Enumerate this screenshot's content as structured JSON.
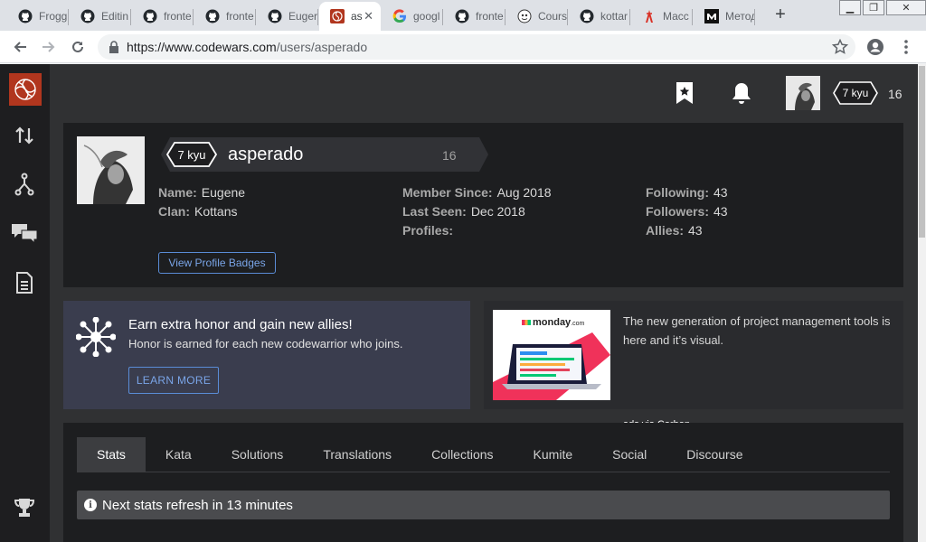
{
  "browser": {
    "tabs": [
      {
        "label": "Frogg",
        "icon": "github-icon"
      },
      {
        "label": "Editin",
        "icon": "github-icon"
      },
      {
        "label": "fronte",
        "icon": "github-icon"
      },
      {
        "label": "fronte",
        "icon": "github-icon"
      },
      {
        "label": "Euger",
        "icon": "github-icon"
      },
      {
        "label": "as",
        "icon": "codewars-icon",
        "active": true
      },
      {
        "label": "googl",
        "icon": "google-icon"
      },
      {
        "label": "fronte",
        "icon": "github-icon"
      },
      {
        "label": "Cours",
        "icon": "course-icon"
      },
      {
        "label": "kottar",
        "icon": "github-icon"
      },
      {
        "label": "Масс",
        "icon": "tower-icon"
      },
      {
        "label": "Метод",
        "icon": "m-icon"
      }
    ],
    "url_host": "https://www.codewars.com",
    "url_path": "/users/asperado"
  },
  "topnav": {
    "rank": "7 kyu",
    "honor": "16"
  },
  "profile": {
    "rank": "7 kyu",
    "username": "asperado",
    "honor": "16",
    "name_label": "Name:",
    "name": "Eugene",
    "clan_label": "Clan:",
    "clan": "Kottans",
    "member_since_label": "Member Since:",
    "member_since": "Aug 2018",
    "last_seen_label": "Last Seen:",
    "last_seen": "Dec 2018",
    "profiles_label": "Profiles:",
    "following_label": "Following:",
    "following": "43",
    "followers_label": "Followers:",
    "followers": "43",
    "allies_label": "Allies:",
    "allies": "43",
    "badges_button": "View Profile Badges"
  },
  "promo": {
    "title": "Earn extra honor and gain new allies!",
    "subtitle": "Honor is earned for each new codewarrior who joins.",
    "button": "LEARN MORE"
  },
  "ad": {
    "brand": "monday",
    "brand_suffix": ".com",
    "text": "The new generation of project management tools is here and it’s visual.",
    "via": "ads via Carbon"
  },
  "stats": {
    "tabs": [
      "Stats",
      "Kata",
      "Solutions",
      "Translations",
      "Collections",
      "Kumite",
      "Social",
      "Discourse"
    ],
    "refresh_message": "Next stats refresh in 13 minutes"
  },
  "colors": {
    "sidebar": "#1e1e20",
    "page_bg": "#303133",
    "card_bg": "#1d1e20",
    "accent_red": "#b1361e",
    "link_blue": "#7aa5e8"
  }
}
